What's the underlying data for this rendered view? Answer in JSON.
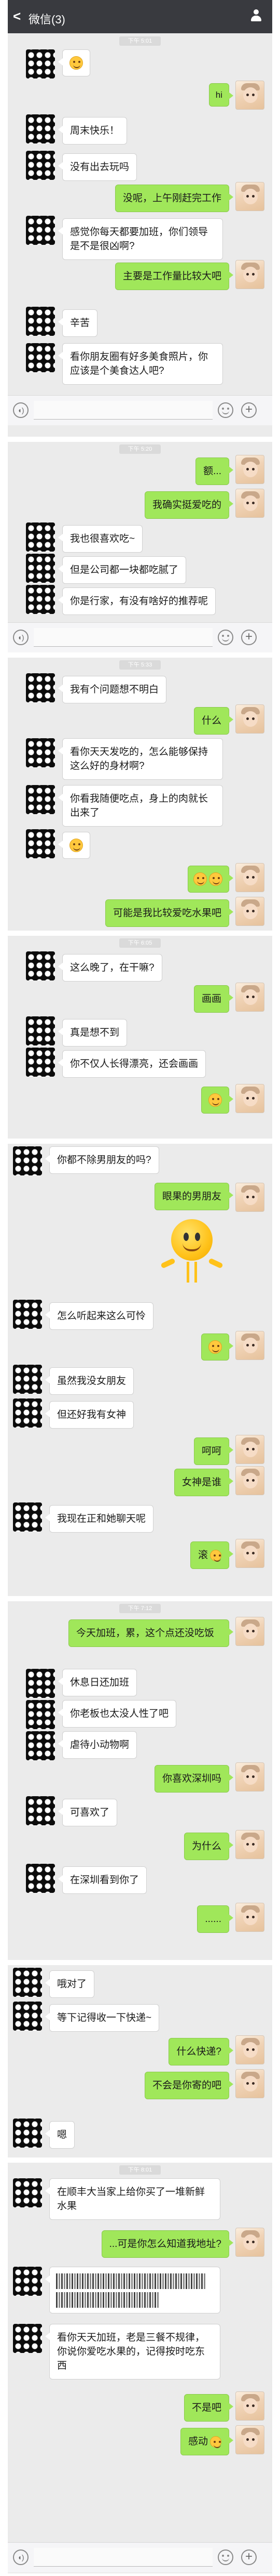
{
  "header": {
    "back_symbol": "<",
    "title": "微信(3)"
  },
  "timestamps": {
    "s1": "下午 5:01",
    "s2": "下午 5:20",
    "s3": "下午 5:33",
    "s4": "下午 6:05",
    "s5": "下午 7:12",
    "s6": "下午 8:01"
  },
  "chat1": [
    "周末快乐！",
    "没有出去玩吗",
    "没呢，上午刚赶完工作",
    "感觉你每天都要加班，你们领导是不是很凶啊?",
    "主要是工作量比较大吧",
    "辛苦",
    "看你朋友圈有好多美食照片，你应该是个美食达人吧?"
  ],
  "chat2": [
    "额...",
    "我确实挺爱吃的",
    "我也很喜欢吃~",
    "但是公司都一块都吃腻了",
    "你是行家，有没有啥好的推荐呢"
  ],
  "chat3": [
    "我有个问题想不明白",
    "什么",
    "看你天天发吃的，怎么能够保持这么好的身材啊?",
    "你看我随便吃点，身上的肉就长出来了",
    "可能是我比较爱吃水果吧"
  ],
  "chat4": [
    "这么晚了，在干嘛?",
    "画画",
    "真是想不到",
    "你不仅人长得漂亮，还会画画"
  ],
  "chat5": [
    "你都不除男朋友的吗?",
    "眼果的男朋友",
    "怎么听起来这么可怜",
    "虽然我没女朋友",
    "但还好我有女神",
    "呵呵",
    "女神是谁",
    "我现在正和她聊天呢",
    "滚"
  ],
  "chat6": [
    "今天加班，累，这个点还没吃饭",
    "休息日还加班",
    "你老板也太没人性了吧",
    "虐待小动物啊",
    "你喜欢深圳吗",
    "可喜欢了",
    "为什么",
    "在深圳看到你了",
    "......"
  ],
  "chat7": [
    "哦对了",
    "等下记得收一下快递~",
    "什么快递?",
    "不会是你寄的吧",
    "嗯"
  ],
  "chat8": [
    "在顺丰大当家上给你买了一堆新鲜水果",
    "...可是你怎么知道我地址?",
    "看你天天加班，老是三餐不规律，你说你爱吃水果的，记得按时吃东西",
    "不是吧",
    "感动"
  ]
}
